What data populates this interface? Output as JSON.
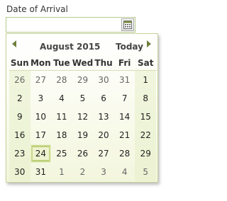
{
  "field": {
    "label": "Date of Arrival",
    "value": "",
    "button_icon": "calendar-icon"
  },
  "calendar": {
    "month": "August",
    "year": "2015",
    "today_label": "Today",
    "prev_icon": "chevron-left-icon",
    "next_icon": "chevron-right-icon",
    "weekdays": [
      "Sun",
      "Mon",
      "Tue",
      "Wed",
      "Thu",
      "Fri",
      "Sat"
    ],
    "weeks": [
      [
        {
          "d": "26",
          "o": true
        },
        {
          "d": "27",
          "o": true
        },
        {
          "d": "28",
          "o": true
        },
        {
          "d": "29",
          "o": true
        },
        {
          "d": "30",
          "o": true
        },
        {
          "d": "31",
          "o": true
        },
        {
          "d": "1",
          "o": false
        }
      ],
      [
        {
          "d": "2",
          "o": false
        },
        {
          "d": "3",
          "o": false
        },
        {
          "d": "4",
          "o": false
        },
        {
          "d": "5",
          "o": false
        },
        {
          "d": "6",
          "o": false
        },
        {
          "d": "7",
          "o": false
        },
        {
          "d": "8",
          "o": false
        }
      ],
      [
        {
          "d": "9",
          "o": false
        },
        {
          "d": "10",
          "o": false
        },
        {
          "d": "11",
          "o": false
        },
        {
          "d": "12",
          "o": false
        },
        {
          "d": "13",
          "o": false
        },
        {
          "d": "14",
          "o": false
        },
        {
          "d": "15",
          "o": false
        }
      ],
      [
        {
          "d": "16",
          "o": false
        },
        {
          "d": "17",
          "o": false
        },
        {
          "d": "18",
          "o": false
        },
        {
          "d": "19",
          "o": false
        },
        {
          "d": "20",
          "o": false
        },
        {
          "d": "21",
          "o": false
        },
        {
          "d": "22",
          "o": false
        }
      ],
      [
        {
          "d": "23",
          "o": false
        },
        {
          "d": "24",
          "o": false,
          "today": true
        },
        {
          "d": "25",
          "o": false
        },
        {
          "d": "26",
          "o": false
        },
        {
          "d": "27",
          "o": false
        },
        {
          "d": "28",
          "o": false
        },
        {
          "d": "29",
          "o": false
        }
      ],
      [
        {
          "d": "30",
          "o": false
        },
        {
          "d": "31",
          "o": false
        },
        {
          "d": "1",
          "o": true
        },
        {
          "d": "2",
          "o": true
        },
        {
          "d": "3",
          "o": true
        },
        {
          "d": "4",
          "o": true
        },
        {
          "d": "5",
          "o": true
        }
      ]
    ]
  }
}
